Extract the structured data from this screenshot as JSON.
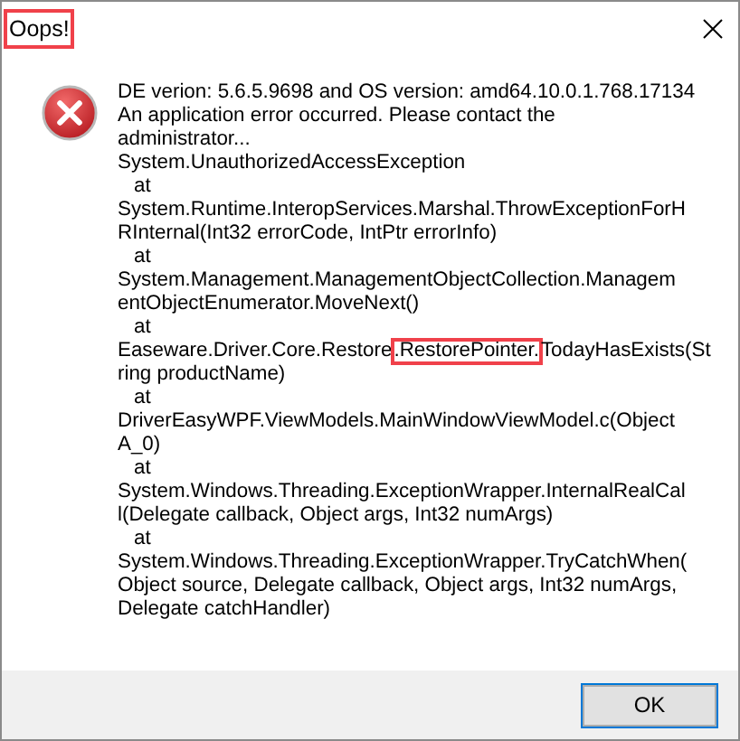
{
  "window": {
    "title": "Oops!",
    "title_marked": true
  },
  "message": {
    "lines": [
      {
        "kind": "plain",
        "text": "DE verion: 5.6.5.9698 and OS version: amd64.10.0.1.768.17134"
      },
      {
        "kind": "plain",
        "text": "An application error occurred. Please contact the"
      },
      {
        "kind": "plain",
        "text": "administrator..."
      },
      {
        "kind": "plain",
        "text": "System.UnauthorizedAccessException"
      },
      {
        "kind": "indented",
        "text": "at"
      },
      {
        "kind": "plain",
        "text": "System.Runtime.InteropServices.Marshal.ThrowExceptionForH"
      },
      {
        "kind": "plain",
        "text": "RInternal(Int32 errorCode, IntPtr errorInfo)"
      },
      {
        "kind": "indented",
        "text": "at"
      },
      {
        "kind": "plain",
        "text": "System.Management.ManagementObjectCollection.Managem"
      },
      {
        "kind": "plain",
        "text": "entObjectEnumerator.MoveNext()"
      },
      {
        "kind": "indented",
        "text": "at"
      },
      {
        "kind": "marked",
        "before": "Easeware.Driver.Core.Restore",
        "marked": ".RestorePointer.",
        "after": "TodayHasExists(St"
      },
      {
        "kind": "plain",
        "text": "ring productName)"
      },
      {
        "kind": "indented",
        "text": "at"
      },
      {
        "kind": "plain",
        "text": "DriverEasyWPF.ViewModels.MainWindowViewModel.c(Object"
      },
      {
        "kind": "plain",
        "text": "A_0)"
      },
      {
        "kind": "indented",
        "text": "at"
      },
      {
        "kind": "plain",
        "text": "System.Windows.Threading.ExceptionWrapper.InternalRealCal"
      },
      {
        "kind": "plain",
        "text": "l(Delegate callback, Object args, Int32 numArgs)"
      },
      {
        "kind": "indented",
        "text": "at"
      },
      {
        "kind": "plain",
        "text": "System.Windows.Threading.ExceptionWrapper.TryCatchWhen("
      },
      {
        "kind": "plain",
        "text": "Object source, Delegate callback, Object args, Int32 numArgs,"
      },
      {
        "kind": "plain",
        "text": "Delegate catchHandler)"
      }
    ]
  },
  "buttons": [
    {
      "label": "OK"
    }
  ]
}
